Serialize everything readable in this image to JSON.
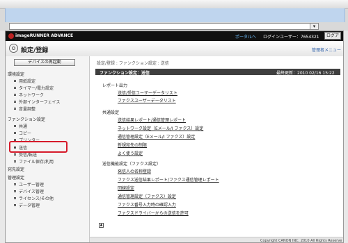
{
  "header": {
    "brand": "imageRUNNER ADVANCE",
    "portal_link": "ポータルへ",
    "login_user": "ログインユーザー：7654321",
    "logout_label": "ログアウ"
  },
  "title_bar": {
    "title": "設定/登録",
    "manager_link": "管理者メニュー"
  },
  "sidebar": {
    "restart_button": "デバイスの再起動",
    "sections": [
      {
        "label": "環境設定",
        "items": [
          "用紙設定",
          "タイマー/電力設定",
          "ネットワーク",
          "外部インターフェイス",
          "音量調整"
        ]
      },
      {
        "label": "ファンクション設定",
        "items": [
          "共通",
          "コピー",
          "プリンター",
          "送信",
          "受信/転送",
          "ファイル保存/利用"
        ]
      },
      {
        "label": "宛先設定",
        "items": []
      },
      {
        "label": "管理設定",
        "items": [
          "ユーザー管理",
          "デバイス管理",
          "ライセンス/その他",
          "データ管理"
        ]
      }
    ],
    "selected": "送信"
  },
  "content": {
    "breadcrumb": "設定/登録 : ファンクション設定 : 送信",
    "panel_title": "ファンクション設定：送信",
    "last_update": "最終更新：2010 02/16 15:22",
    "groups": [
      {
        "title": "レポート出力",
        "links": [
          "送信/受信ユーザーデータリスト",
          "ファクスユーザーデータリスト"
        ]
      },
      {
        "title": "共通設定",
        "links": [
          "送信結果レポート/通信管理レポート",
          "ネットワーク設定（Eメール/I ファクス）設定",
          "通信管理設定（Eメール/I ファクス）設定",
          "新規宛先の制限",
          "よく使う設定"
        ]
      },
      {
        "title": "送信機能設定（ファクス設定）",
        "links": [
          "発信人の名称登録",
          "ファクス送信結果レポート/ファクス通信管理レポート",
          "回線設定",
          "通信管理設定（ファクス）設定",
          "ファクス番号入力時の確認入力",
          "ファクスドライバーからの送信を許可"
        ]
      }
    ],
    "copyright": "Copyright CANON INC. 2010 All Rights Reserve"
  }
}
